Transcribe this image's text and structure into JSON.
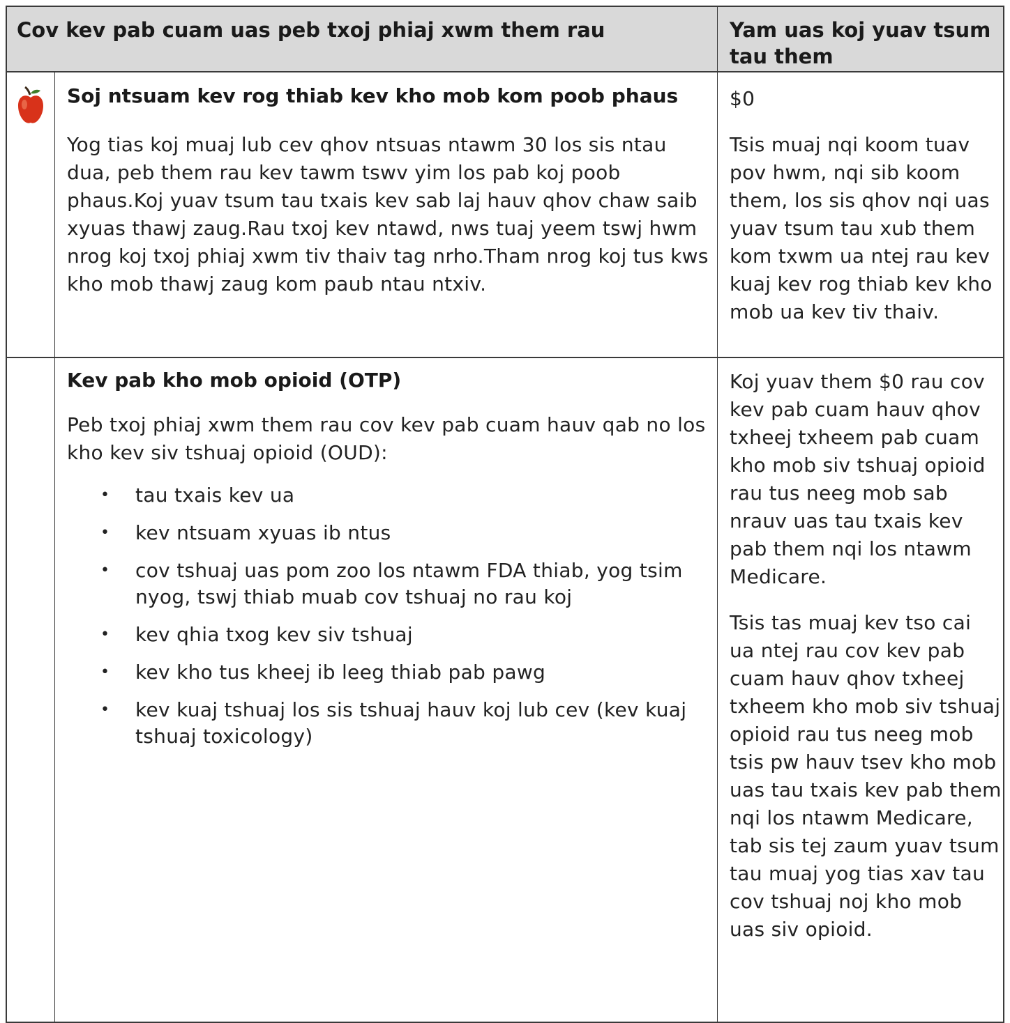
{
  "header": {
    "left": "Cov kev pab cuam uas peb txoj phiaj xwm them rau",
    "right": "Yam uas koj yuav tsum tau them"
  },
  "row1": {
    "icon": "apple-icon",
    "title": "Soj ntsuam kev rog thiab kev kho mob kom poob phaus",
    "body": "Yog tias koj muaj lub cev qhov ntsuas ntawm 30 los sis ntau dua, peb them rau kev tawm tswv yim los pab koj poob phaus.Koj yuav tsum tau txais kev sab laj hauv qhov chaw saib xyuas thawj zaug.Rau txoj kev ntawd, nws tuaj yeem tswj hwm nrog koj txoj phiaj xwm tiv thaiv tag nrho.Tham nrog koj tus kws kho mob thawj zaug kom paub ntau ntxiv.",
    "cost_amount": "$0",
    "cost_note": "Tsis muaj nqi koom tuav pov hwm, nqi sib koom them, los sis qhov nqi uas yuav tsum tau xub them kom txwm ua ntej rau kev kuaj kev rog thiab kev kho mob ua kev tiv thaiv."
  },
  "row2": {
    "title": "Kev pab kho mob opioid (OTP)",
    "intro": "Peb txoj phiaj xwm them rau cov kev pab cuam hauv qab no los kho kev siv tshuaj opioid (OUD):",
    "bullets": [
      "tau txais kev ua",
      "kev ntsuam xyuas ib ntus",
      "cov tshuaj uas pom zoo los ntawm FDA thiab, yog tsim nyog, tswj thiab muab cov tshuaj no rau koj",
      "kev qhia txog kev siv tshuaj",
      "kev kho tus kheej ib leeg thiab pab pawg",
      "kev kuaj tshuaj los sis tshuaj hauv koj lub cev (kev kuaj tshuaj toxicology)"
    ],
    "bullet_glyph": "•",
    "cost_para1": "Koj yuav them $0 rau cov kev pab cuam hauv qhov txheej txheem pab cuam kho mob siv tshuaj opioid rau tus neeg mob sab nrauv uas tau txais kev pab them nqi los ntawm Medicare.",
    "cost_para2": "Tsis tas muaj kev tso cai ua ntej rau cov kev pab cuam hauv qhov txheej txheem kho mob siv tshuaj opioid rau tus neeg mob tsis pw hauv tsev kho mob uas tau txais kev pab them nqi los ntawm Medicare, tab sis tej zaum yuav tsum tau muaj yog tias xav tau cov tshuaj noj kho mob uas siv opioid."
  },
  "colors": {
    "header_bg": "#d9d9d9",
    "border": "#3a3a3a",
    "apple_red": "#d8321a"
  }
}
